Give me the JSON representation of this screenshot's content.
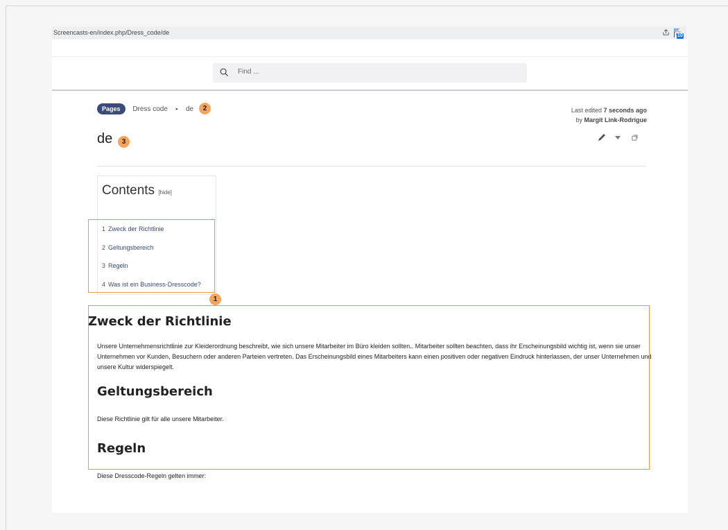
{
  "browser": {
    "url": "Screencasts-en/index.php/Dress_code/de",
    "actions": [
      "share-icon",
      "star-icon"
    ],
    "extension_badge": "10"
  },
  "search": {
    "placeholder": "Find ..."
  },
  "breadcrumb": {
    "pill": "Pages",
    "parent": "Dress code",
    "current": "de"
  },
  "markers": {
    "m1": "1",
    "m2": "2",
    "m3": "3"
  },
  "edit_info": {
    "prefix": "Last edited ",
    "time": "7 seconds ago",
    "by_prefix": "by ",
    "author": "Margit Link-Rodrigue"
  },
  "page_title": "de",
  "toc": {
    "title": "Contents",
    "hide": "[hide]",
    "items": [
      {
        "num": "1",
        "label": "Zweck der Richtlinie"
      },
      {
        "num": "2",
        "label": "Geltungsbereich"
      },
      {
        "num": "3",
        "label": "Regeln"
      },
      {
        "num": "4",
        "label": "Was ist ein Business-Dresscode?"
      }
    ]
  },
  "article": {
    "s1_heading": "Zweck der Richtlinie",
    "s1_text": "Unsere Unternehmensrichtlinie zur Kleiderordnung beschreibt, wie sich unsere Mitarbeiter im Büro kleiden sollten.. Mitarbeiter sollten beachten, dass ihr Erscheinungsbild wichtig ist, wenn sie unser Unternehmen vor Kunden, Besuchern oder anderen Parteien vertreten. Das Erscheinungsbild eines Mitarbeiters kann einen positiven oder negativen Eindruck hinterlassen, der unser Unternehmen und unsere Kultur widerspiegelt.",
    "s2_heading": "Geltungsbereich",
    "s2_text": "Diese Richtlinie gilt für alle unsere Mitarbeiter.",
    "s3_heading": "Regeln",
    "s3_text": "Diese Dresscode-Regeln gelten immer:"
  },
  "colors": {
    "accent": "#3b4a7a",
    "highlight": "#f39a3c",
    "marker": "#f5a55f"
  }
}
